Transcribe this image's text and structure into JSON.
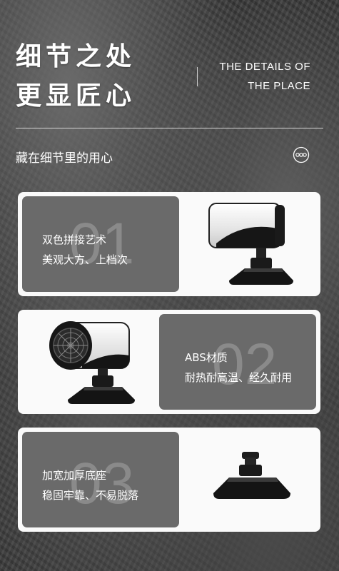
{
  "header": {
    "title_line1": "细节之处",
    "title_line2": "更显匠心",
    "en_line1": "THE DETAILS OF",
    "en_line2": "THE PLACE"
  },
  "subtitle": "藏在细节里的用心",
  "deco_icon": "three-circles-link-icon",
  "features": [
    {
      "number": "01",
      "line1": "双色拼接艺术",
      "line2": "美观大方、上档次",
      "image": "heater-side-view"
    },
    {
      "number": "02",
      "line1": "ABS材质",
      "line2": "耐热耐高温、经久耐用",
      "image": "heater-fan-view"
    },
    {
      "number": "03",
      "line1": "加宽加厚底座",
      "line2": "稳固牢靠、不易脱落",
      "image": "base-mount"
    }
  ],
  "colors": {
    "panel": "#6a6a6a",
    "card": "#fafafa",
    "product_dark": "#1c1c1c"
  }
}
